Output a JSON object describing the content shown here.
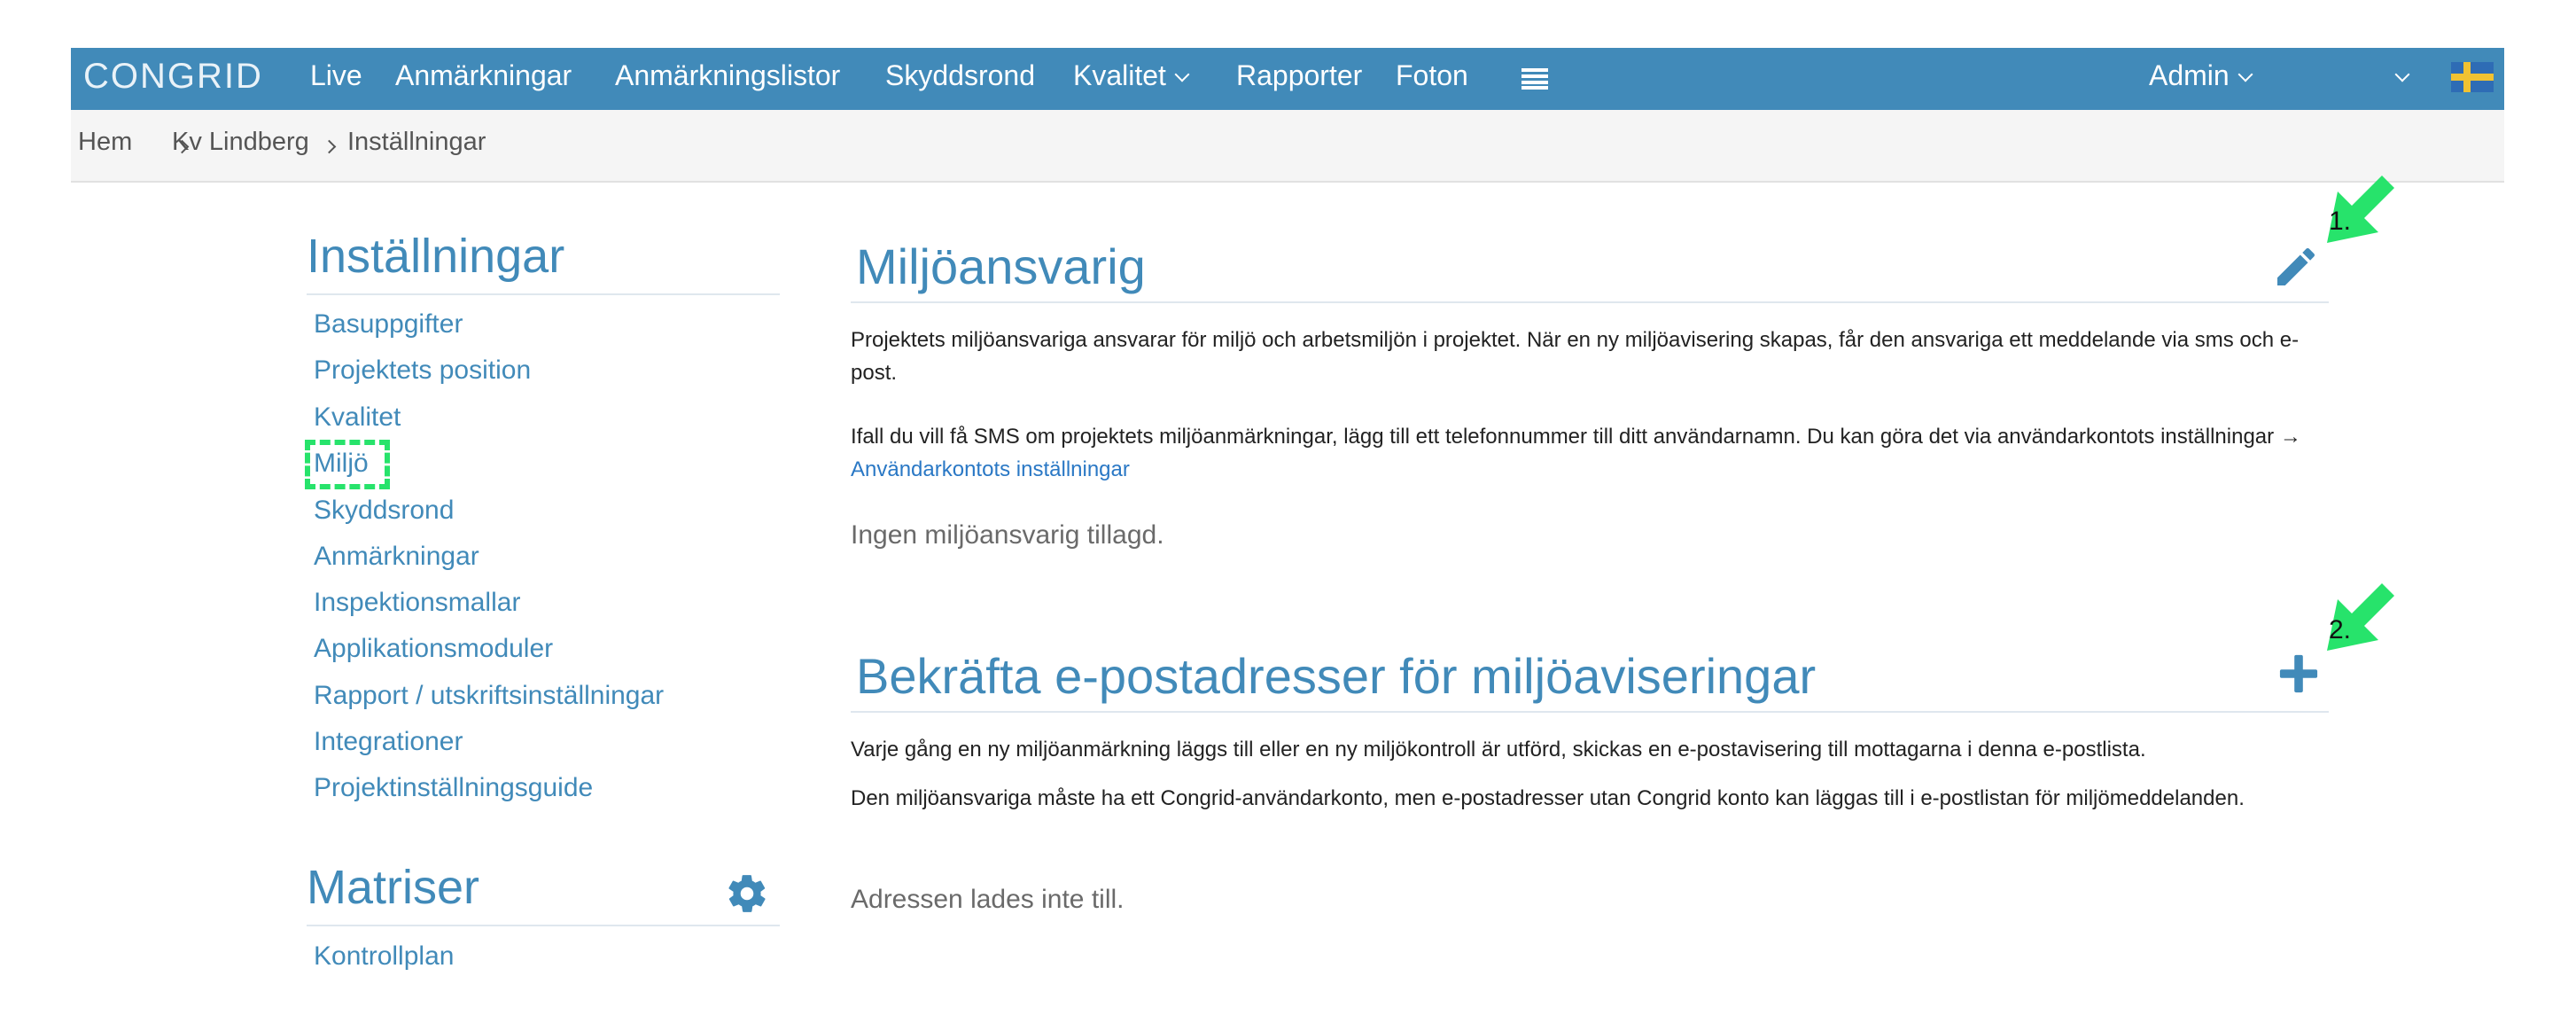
{
  "navbar": {
    "logo": "CONGRID",
    "items": [
      "Live",
      "Anmärkningar",
      "Anmärkningslistor",
      "Skyddsrond",
      "Kvalitet",
      "Rapporter",
      "Foton"
    ],
    "user": "Admin",
    "icons": [
      "list-icon",
      "chevron-down-icon",
      "swedish-flag-icon"
    ],
    "color": "#418ab9"
  },
  "breadcrumb": [
    "Hem",
    "Kv Lindberg",
    "Inställningar"
  ],
  "sidebar": {
    "settings_title": "Inställningar",
    "items": [
      "Basuppgifter",
      "Projektets position",
      "Kvalitet",
      "Miljö",
      "Skyddsrond",
      "Anmärkningar",
      "Inspektionsmallar",
      "Applikationsmoduler",
      "Rapport / utskriftsinställningar",
      "Integrationer",
      "Projektinställningsguide"
    ],
    "matrices_title": "Matriser",
    "matrices_items": [
      "Kontrollplan"
    ]
  },
  "main": {
    "section1": {
      "title": "Miljöansvarig",
      "p1": "Projektets miljöansvariga ansvarar för miljö och arbetsmiljön i projektet. När en ny miljöavisering skapas, får den ansvariga ett meddelande via sms och e-post.",
      "p2_text": "Ifall du vill få SMS om projektets miljöanmärkningar, lägg till ett telefonnummer till ditt användarnamn. Du kan göra det via användarkontots inställningar →",
      "p2_link": "Användarkontots inställningar",
      "empty": "Ingen miljöansvarig tillagd."
    },
    "section2": {
      "title": "Bekräfta e-postadresser för miljöaviseringar",
      "p1": "Varje gång en ny miljöanmärkning läggs till eller en ny miljökontroll är utförd, skickas en e-postavisering till mottagarna i denna e-postlista.",
      "p2": "Den miljöansvariga måste ha ett Congrid-användarkonto, men e-postadresser utan Congrid konto kan läggas till i e-postlistan för miljömeddelanden.",
      "empty": "Adressen lades inte till."
    }
  },
  "annotations": {
    "marker1": "1.",
    "marker2": "2.",
    "color": "#27e36b"
  }
}
